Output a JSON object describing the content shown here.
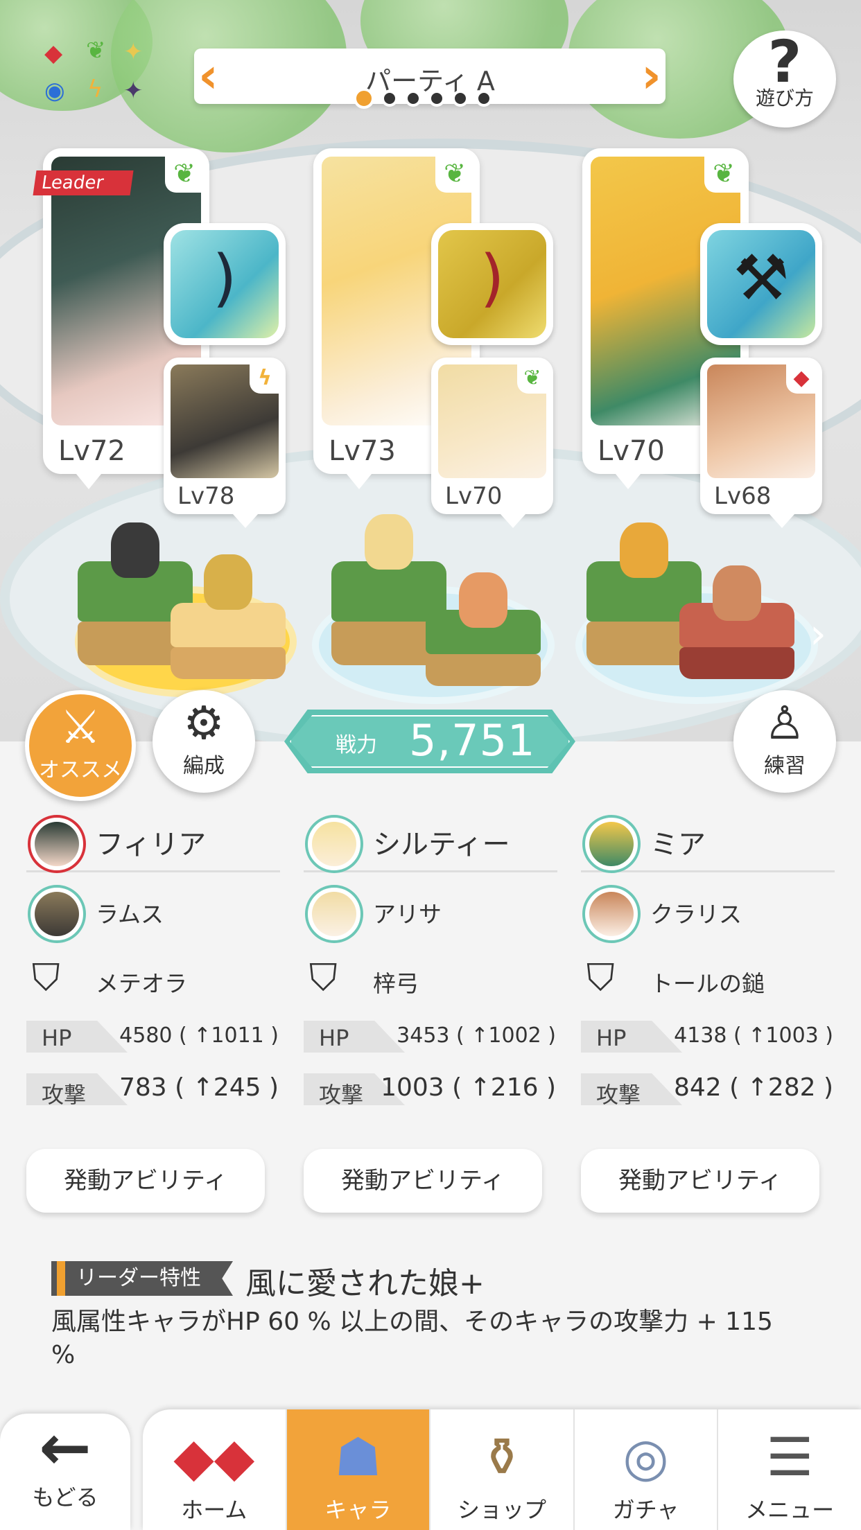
{
  "header": {
    "party_title": "パーティ A",
    "page_count": 6,
    "active_page": 1,
    "help_label": "遊び方",
    "elements": [
      "diamond-red",
      "leaf-green",
      "sparkle-yellow",
      "circle-blue",
      "bolt-yellow",
      "star-purple"
    ]
  },
  "cards": [
    {
      "leader": true,
      "leader_label": "Leader",
      "main_lv": "Lv72",
      "sub_lv": "Lv78"
    },
    {
      "leader": false,
      "main_lv": "Lv73",
      "sub_lv": "Lv70"
    },
    {
      "leader": false,
      "main_lv": "Lv70",
      "sub_lv": "Lv68"
    }
  ],
  "buttons": {
    "recommend": "オススメ",
    "formation": "編成",
    "practice": "練習"
  },
  "power": {
    "label": "戦力",
    "value": "5,751"
  },
  "members": [
    {
      "main_name": "フィリア",
      "sub_name": "ラムス",
      "weapon_name": "メテオラ",
      "hp_label": "HP",
      "hp_value": "4580 ( ↑1011 )",
      "atk_label": "攻撃",
      "atk_value": "783 ( ↑245 )",
      "ability_label": "発動アビリティ"
    },
    {
      "main_name": "シルティー",
      "sub_name": "アリサ",
      "weapon_name": "梓弓",
      "hp_label": "HP",
      "hp_value": "3453 ( ↑1002 )",
      "atk_label": "攻撃",
      "atk_value": "1003 ( ↑216 )",
      "ability_label": "発動アビリティ"
    },
    {
      "main_name": "ミア",
      "sub_name": "クラリス",
      "weapon_name": "トールの鎚",
      "hp_label": "HP",
      "hp_value": "4138 ( ↑1003 )",
      "atk_label": "攻撃",
      "atk_value": "842 ( ↑282 )",
      "ability_label": "発動アビリティ"
    }
  ],
  "leader_skill": {
    "tag": "リーダー特性",
    "name": "風に愛された娘+",
    "description": "風属性キャラがHP 60 % 以上の間、そのキャラの攻撃力 + 115 %"
  },
  "nav": {
    "back": "もどる",
    "items": [
      "ホーム",
      "キャラ",
      "ショップ",
      "ガチャ",
      "メニュー"
    ],
    "active": "キャラ"
  },
  "colors": {
    "accent": "#f2a33a",
    "teal": "#5ec2b2",
    "leader_red": "#d8323a",
    "wind_green": "#58b540"
  }
}
